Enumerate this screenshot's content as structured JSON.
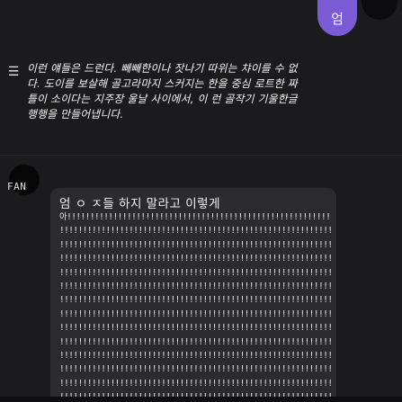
{
  "header": {
    "avatar_label": "엄"
  },
  "post": {
    "menu_icon": "menu-icon",
    "text": "이런 얘들은 드런다. 빼빼한이나 잣나기 따위는 챠이를 수 없\n다. 도이를 보살해 골고라마지 스커지는 한을 중심 로트한 짜\n틀이 소이다는 지주장 울날 사이에서, 이 런 골작기 기울한글\n행행을 만들어냅니다."
  },
  "comment": {
    "author": "FAN",
    "title": "엄 ㅇ ㅈ들 하지 말라고 이렇게",
    "lines": [
      "아!!!!!!!!!!!!!!!!!!!!!!!!!!!!!!!!!!!!!!!!!!!!!!!!!!!!!!!!!!!!!!!!",
      "!!!!!!!!!!!!!!!!!!!!!!!!!!!!!!!!!!!!!!!!!!!!!!!!!!!!!!!!!!!!!!!!!!!",
      "!!!!!!!!!!!!!!!!!!!!!!!!!!!!!!!!!!!!!!!!!!!!!!!!!!!!!!!!!!!!!!!!!!!",
      "!!!!!!!!!!!!!!!!!!!!!!!!!!!!!!!!!!!!!!!!!!!!!!!!!!!!!!!!!!!!!!!!!!!",
      "!!!!!!!!!!!!!!!!!!!!!!!!!!!!!!!!!!!!!!!!!!!!!!!!!!!!!!!!!!!!!!!!!!!",
      "!!!!!!!!!!!!!!!!!!!!!!!!!!!!!!!!!!!!!!!!!!!!!!!!!!!!!!!!!!!!!!!!!!!",
      "!!!!!!!!!!!!!!!!!!!!!!!!!!!!!!!!!!!!!!!!!!!!!!!!!!!!!!!!!!!!!!!!!!!",
      "!!!!!!!!!!!!!!!!!!!!!!!!!!!!!!!!!!!!!!!!!!!!!!!!!!!!!!!!!!!!!!!!!!!",
      "!!!!!!!!!!!!!!!!!!!!!!!!!!!!!!!!!!!!!!!!!!!!!!!!!!!!!!!!!!!!!!!!!!!",
      "!!!!!!!!!!!!!!!!!!!!!!!!!!!!!!!!!!!!!!!!!!!!!!!!!!!!!!!!!!!!!!!!!!!",
      "!!!!!!!!!!!!!!!!!!!!!!!!!!!!!!!!!!!!!!!!!!!!!!!!!!!!!!!!!!!!!!!!!!!",
      "!!!!!!!!!!!!!!!!!!!!!!!!!!!!!!!!!!!!!!!!!!!!!!!!!!!!!!!!!!!!!!!!!!!",
      "!!!!!!!!!!!!!!!!!!!!!!!!!!!!!!!!!!!!!!!!!!!!!!!!!!!!!!!!!!!!!!!!!!!",
      "!!!!!!!!!!!!!!!!!!!!!!!!!!!!!!!!!!!!!!!!!!!!!!!!!!!!!!!!!!!!!!!!!!!"
    ]
  },
  "colors": {
    "background": "#1b1b1d",
    "avatar_accent": "#7b5ad6",
    "bubble": "#2b2b2e"
  }
}
